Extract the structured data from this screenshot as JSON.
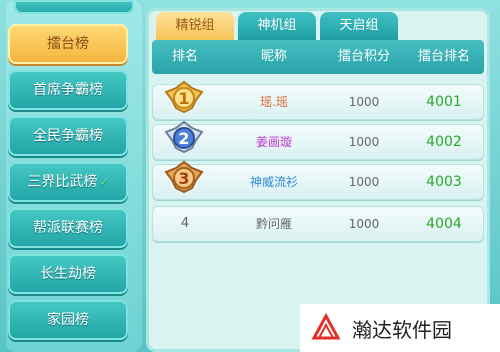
{
  "sidebar": {
    "items": [
      {
        "label": "擂台榜",
        "active": true
      },
      {
        "label": "首席争霸榜"
      },
      {
        "label": "全民争霸榜"
      },
      {
        "label": "三界比武榜",
        "chevron": "✓"
      },
      {
        "label": "帮派联赛榜"
      },
      {
        "label": "长生劫榜"
      },
      {
        "label": "家园榜"
      }
    ]
  },
  "tabs": [
    "精锐组",
    "神机组",
    "天启组"
  ],
  "table": {
    "headers": [
      "排名",
      "昵称",
      "擂台积分",
      "擂台排名"
    ],
    "rows": [
      {
        "rank": "1",
        "name": "瑶.瑶",
        "score": "1000",
        "position": "4001",
        "name_color": "#e06a3a"
      },
      {
        "rank": "2",
        "name": "姜画璇",
        "score": "1000",
        "position": "4002",
        "name_color": "#c03ad0"
      },
      {
        "rank": "3",
        "name": "神威流衫",
        "score": "1000",
        "position": "4003",
        "name_color": "#2f88d8"
      },
      {
        "rank": "4",
        "name": "黔问雁",
        "score": "1000",
        "position": "4004",
        "name_color": "#666666"
      }
    ]
  },
  "watermark": {
    "text": "瀚达软件园"
  }
}
